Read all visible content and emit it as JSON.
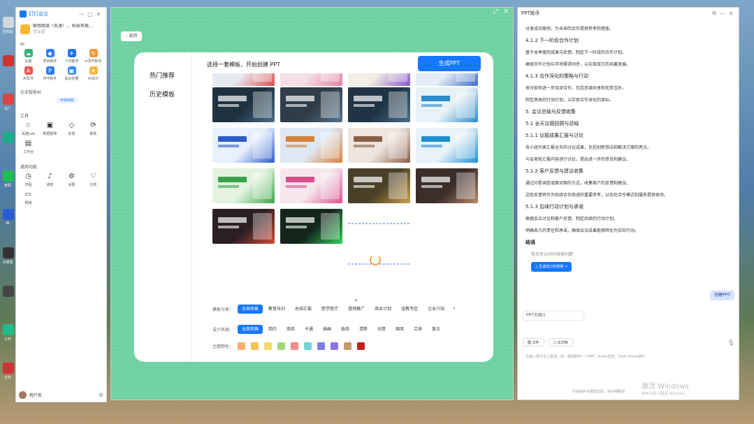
{
  "desktop": {
    "icons": [
      {
        "label": "回收站",
        "color": "#cfd8e0"
      },
      {
        "label": "",
        "color": "#c33"
      },
      {
        "label": "大厂",
        "color": "#d44"
      },
      {
        "label": "",
        "color": "#2a8"
      },
      {
        "label": "考研",
        "color": "#2b5"
      },
      {
        "label": "W",
        "color": "#2a5bd7"
      },
      {
        "label": "大修改",
        "color": "#333"
      },
      {
        "label": "",
        "color": "#444"
      },
      {
        "label": "工作",
        "color": "#2b8"
      },
      {
        "label": "文件",
        "color": "#c33"
      }
    ]
  },
  "left_panel": {
    "brand": "钉钉会议",
    "org_name": "联想商旅（天津）… 科技有限…",
    "org_sub": "已认证",
    "ai_title": "AI",
    "ai_apps": [
      {
        "label": "云盘",
        "color": "#36b37e",
        "icon": "☁"
      },
      {
        "label": "项目助手",
        "color": "#2f7cf6",
        "icon": "◆"
      },
      {
        "label": "飞书助手",
        "color": "#1a73e8",
        "icon": "✈"
      },
      {
        "label": "ai写作助手",
        "color": "#f59a3a",
        "icon": "✎"
      },
      {
        "label": "AI写作",
        "color": "#f25252",
        "icon": "A"
      },
      {
        "label": "PPT助手",
        "color": "#2f7cf6",
        "icon": "P"
      },
      {
        "label": "会议纪要",
        "color": "#3c8bf7",
        "icon": "▣"
      },
      {
        "label": "AI设计",
        "color": "#f2b84b",
        "icon": "✦"
      }
    ],
    "enterprise_title": "企业智能AI",
    "badge": "开启体验",
    "tools_title": "工具",
    "tools": [
      {
        "label": "百度Lab",
        "icon": "☆"
      },
      {
        "label": "数据报表",
        "icon": "▣"
      },
      {
        "label": "反馈",
        "icon": "◇"
      },
      {
        "label": "联系",
        "icon": "⟳"
      },
      {
        "label": "工作台",
        "icon": "▤"
      }
    ],
    "common_title": "通用功能",
    "common": [
      {
        "label": "日程",
        "icon": "◷"
      },
      {
        "label": "通知",
        "icon": "♪"
      },
      {
        "label": "设置",
        "icon": "⚙"
      },
      {
        "label": "分享",
        "icon": "♡"
      },
      {
        "label": "网络",
        "icon": "▭"
      }
    ],
    "user_name": "用户名"
  },
  "middle": {
    "back_label": "‹ 返回",
    "side_items": [
      "热门推荐",
      "历史模板"
    ],
    "heading": "选择一套模板，开始创建 PPT",
    "generate_label": "生成PPT",
    "templates": [
      {
        "c1": "#e8eaf2",
        "c2": "#d94f4f"
      },
      {
        "c1": "#f4dfe6",
        "c2": "#e77fa0"
      },
      {
        "c1": "#f1efe3",
        "c2": "#8a55c9"
      },
      {
        "c1": "#e4ecf5",
        "c2": "#3b6fc9"
      },
      {
        "c1": "#1f3240",
        "c2": "#4a6f86"
      },
      {
        "c1": "#2f3d48",
        "c2": "#5a7489"
      },
      {
        "c1": "#203445",
        "c2": "#4f6e8a"
      },
      {
        "c1": "#e8f1f6",
        "c2": "#2d8bc9"
      },
      {
        "c1": "#e9f0fb",
        "c2": "#2d5cc7"
      },
      {
        "c1": "#dde8f4",
        "c2": "#d4813b"
      },
      {
        "c1": "#ede5de",
        "c2": "#8a5f4a"
      },
      {
        "c1": "#e6f2f8",
        "c2": "#1c8fd0"
      },
      {
        "c1": "#e3f3df",
        "c2": "#3aa34a"
      },
      {
        "c1": "#f5e6ec",
        "c2": "#d9508b"
      },
      {
        "c1": "#4a4028",
        "c2": "#c9a24a"
      },
      {
        "c1": "#3a2d2a",
        "c2": "#b78b6b"
      },
      {
        "c1": "#2b1f24",
        "c2": "#d14b3a"
      },
      {
        "c1": "#14261b",
        "c2": "#2fd05a"
      }
    ],
    "filters": [
      {
        "label": "模板分类：",
        "chips": [
          "全部场景",
          "教育培训",
          "总结汇报",
          "医学医疗",
          "营销推广",
          "商业计划",
          "宣教专区",
          "企业介绍"
        ],
        "active": 0
      },
      {
        "label": "设计风格：",
        "chips": [
          "全部风格",
          "简约",
          "商务",
          "卡通",
          "插画",
          "政务",
          "清新",
          "创意",
          "国风",
          "立体",
          "复古"
        ],
        "active": 0
      }
    ],
    "color_label": "主题颜色：",
    "colors": [
      "#f6b26b",
      "#f4c35a",
      "#f3d86b",
      "#9ed87a",
      "#f28b8b",
      "#6fd3d8",
      "#7b7fe0",
      "#8f74e0",
      "#c69a6b",
      "#c9201f"
    ]
  },
  "right_panel": {
    "title": "PPT助手",
    "lines": [
      {
        "t": "分享成功案例，为未来的合作提供参考和借鉴。",
        "h": false
      },
      {
        "t": "4.1.2 下一阶段合作计划",
        "h": true
      },
      {
        "t": "基于本季度的成果与反馈，制定下一阶段的合作计划。",
        "h": false
      },
      {
        "t": "确保合作计划与市场需求同步，以实现双方的共赢发展。",
        "h": false
      },
      {
        "t": "4.1.3 合作深化的策略与行动",
        "h": true
      },
      {
        "t": "探讨如何进一步加深合作，包括资源共享和优势互补。",
        "h": false
      },
      {
        "t": "制定具体的行动计划，以实现合作深化的目标。",
        "h": false
      },
      {
        "t": "5. 会议总结与反馈收集",
        "h": true
      },
      {
        "t": "5.1 全天议题回顾与总结",
        "h": true
      },
      {
        "t": "5.1.1 议题成果汇报与讨论",
        "h": true
      },
      {
        "t": "各小组代表汇报全天的讨论成果，包括创新想法和解决方案的亮点。",
        "h": false
      },
      {
        "t": "与会者就汇报内容进行讨论，提出进一步的意见和建议。",
        "h": false
      },
      {
        "t": "5.1.2 客户反馈与建议收集",
        "h": true
      },
      {
        "t": "通过问卷调查或面对面的方式，收集客户的反馈和建议。",
        "h": false
      },
      {
        "t": "这些反馈将作为后续合作改进的重要参考，以优化合作模式和服务提供体验。",
        "h": false
      },
      {
        "t": "5.1.3 后续行动计划与承诺",
        "h": true
      },
      {
        "t": "根据会议讨论和客户反馈，制定后续的行动计划。",
        "h": false
      },
      {
        "t": "明确各方的责任和承诺，确保会议成果能够转化为实际行动。",
        "h": false
      }
    ],
    "end_title": "结语",
    "tip": "你也可以问问其他问题",
    "gen_btn": "△ 生成该分析表格 ↗",
    "me_msg": "创建PPT",
    "file_label": "PPT大纲.t",
    "inbar": [
      "图 文件",
      "☐ 云文档"
    ],
    "placeholder": "在输入框中写上需求，如：帮我制作一个PPT…Enter发送，Shift+Enter换行",
    "footer": "内容由AI大模型生成，请仔细甄别",
    "watermark1": "激活 Windows",
    "watermark2": "转到'设置'以激活 Windows。"
  }
}
